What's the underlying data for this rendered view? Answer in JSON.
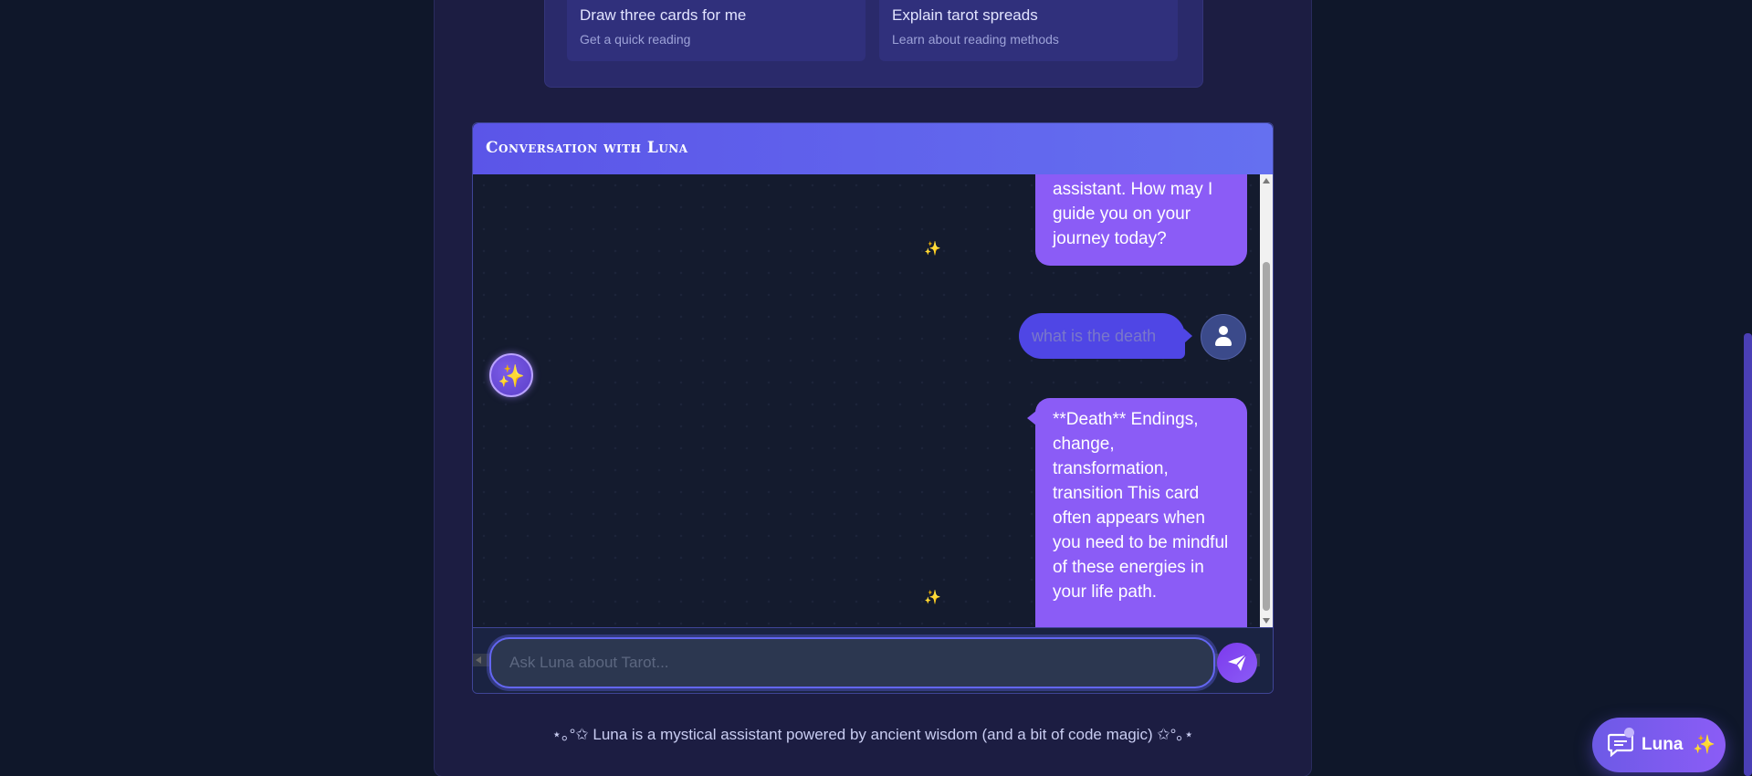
{
  "quick_actions": [
    {
      "title": "Draw three cards for me",
      "subtitle": "Get a quick reading"
    },
    {
      "title": "Explain tarot spreads",
      "subtitle": "Learn about reading methods"
    }
  ],
  "chat": {
    "title": "Conversation with Luna",
    "messages": [
      {
        "role": "assistant",
        "text": "assistant. How may I guide you on your journey today?"
      },
      {
        "role": "user",
        "text": "what is the death"
      },
      {
        "role": "assistant",
        "text": "**Death** Endings, change, transformation, transition This card often appears when you need to be mindful of these energies in your life path."
      }
    ],
    "sparkle_glyph": "✨",
    "ai_avatar_glyph": "✨"
  },
  "input": {
    "placeholder": "Ask Luna about Tarot...",
    "value": ""
  },
  "footer": {
    "text": "⋆｡°✩ Luna is a mystical assistant powered by ancient wisdom (and a bit of code magic) ✩°｡⋆"
  },
  "fab": {
    "label": "Luna",
    "sparkle": "✨"
  },
  "colors": {
    "background": "#0f172a",
    "accent": "#6366f1",
    "assistant_bubble": "#8b5cf6",
    "user_bubble": "#4f46e5"
  }
}
